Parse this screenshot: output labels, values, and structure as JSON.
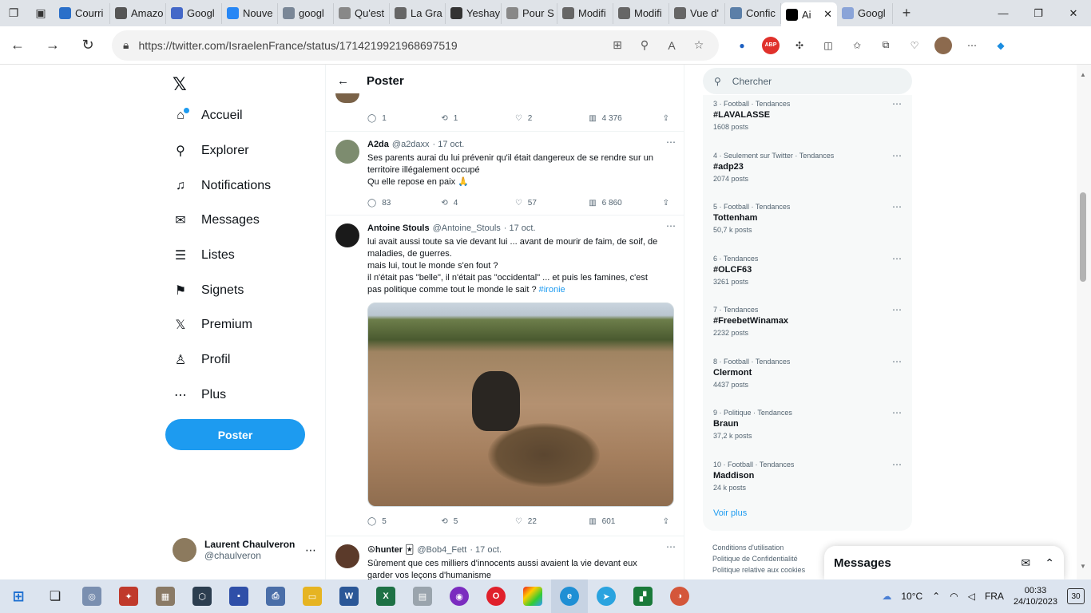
{
  "browser": {
    "tabs": [
      {
        "label": "Courri",
        "icon": "outlook-icon",
        "color": "#2a6fc9"
      },
      {
        "label": "Amazo",
        "icon": "amazon-icon",
        "color": "#555555"
      },
      {
        "label": "Googl",
        "icon": "google-icon",
        "color": "#4468c8"
      },
      {
        "label": "Nouve",
        "icon": "vk-icon",
        "color": "#2787f5"
      },
      {
        "label": "googl",
        "icon": "search-icon",
        "color": "#7a8797"
      },
      {
        "label": "Qu'est",
        "icon": "page-icon",
        "color": "#888888"
      },
      {
        "label": "La Gra",
        "icon": "wikipedia-icon",
        "color": "#666666"
      },
      {
        "label": "Yeshay",
        "icon": "wikipedia-icon",
        "color": "#333333"
      },
      {
        "label": "Pour S",
        "icon": "page-icon",
        "color": "#888888"
      },
      {
        "label": "Modifi",
        "icon": "page-icon",
        "color": "#666666"
      },
      {
        "label": "Modifi",
        "icon": "page-icon",
        "color": "#666666"
      },
      {
        "label": "Vue d'",
        "icon": "page-icon",
        "color": "#666666"
      },
      {
        "label": "Confic",
        "icon": "page-icon",
        "color": "#5b7fa8"
      },
      {
        "label": "Ai",
        "icon": "x-icon",
        "color": "#000000",
        "active": true
      },
      {
        "label": "Googl",
        "icon": "google-icon",
        "color": "#8aa4d8"
      }
    ],
    "url": "https://twitter.com/IsraelenFrance/status/1714219921968697519"
  },
  "sidebar": {
    "logo": "𝕏",
    "items": [
      {
        "label": "Accueil",
        "icon": "home-icon",
        "glyph": "⌂"
      },
      {
        "label": "Explorer",
        "icon": "search-icon",
        "glyph": "⚲"
      },
      {
        "label": "Notifications",
        "icon": "bell-icon",
        "glyph": "♫"
      },
      {
        "label": "Messages",
        "icon": "mail-icon",
        "glyph": "✉"
      },
      {
        "label": "Listes",
        "icon": "list-icon",
        "glyph": "☰"
      },
      {
        "label": "Signets",
        "icon": "bookmark-icon",
        "glyph": "⚑"
      },
      {
        "label": "Premium",
        "icon": "x-icon",
        "glyph": "𝕏"
      },
      {
        "label": "Profil",
        "icon": "profile-icon",
        "glyph": "♙"
      },
      {
        "label": "Plus",
        "icon": "more-icon",
        "glyph": "⋯"
      }
    ],
    "post_button": "Poster",
    "user": {
      "name": "Laurent Chaulveron",
      "handle": "@chaulveron"
    }
  },
  "feed": {
    "header": "Poster",
    "top_actions": {
      "replies": "1",
      "retweets": "1",
      "likes": "2",
      "views": "4 376"
    },
    "tweets": [
      {
        "name": "A2da",
        "handle": "@a2daxx",
        "date": "· 17 oct.",
        "lines": [
          "Ses parents aurai du lui prévenir qu'il était dangereux de se rendre sur un",
          "territoire illégalement occupé",
          "Qu elle repose en paix 🙏"
        ],
        "replies": "83",
        "retweets": "4",
        "likes": "57",
        "views": "6 860"
      },
      {
        "name": "Antoine Stouls",
        "handle": "@Antoine_Stouls",
        "date": "· 17 oct.",
        "lines": [
          "lui avait aussi toute sa vie devant lui ... avant de mourir de faim, de soif, de",
          "maladies, de guerres.",
          "mais lui, tout le monde s'en fout ?",
          "il n'était pas \"belle\", il n'était pas \"occidental\" ... et puis les famines, c'est",
          "pas politique comme tout le monde le sait ?"
        ],
        "hashtag": "#ironie",
        "replies": "5",
        "retweets": "5",
        "likes": "22",
        "views": "601"
      },
      {
        "name": "☮hunter 🃏",
        "handle": "@Bob4_Fett",
        "date": "· 17 oct.",
        "lines": [
          "Sûrement que ces milliers d'innocents aussi avaient la vie devant eux",
          "garder vos leçons d'humanisme"
        ]
      }
    ]
  },
  "right": {
    "search_placeholder": "Chercher",
    "trends": [
      {
        "category": "3 · Football · Tendances",
        "title": "#LAVALASSE",
        "posts": "1608 posts"
      },
      {
        "category": "4 · Seulement sur Twitter · Tendances",
        "title": "#adp23",
        "posts": "2074 posts"
      },
      {
        "category": "5 · Football · Tendances",
        "title": "Tottenham",
        "posts": "50,7 k posts"
      },
      {
        "category": "6 · Tendances",
        "title": "#OLCF63",
        "posts": "3261 posts"
      },
      {
        "category": "7 · Tendances",
        "title": "#FreebetWinamax",
        "posts": "2232 posts"
      },
      {
        "category": "8 · Football · Tendances",
        "title": "Clermont",
        "posts": "4437 posts"
      },
      {
        "category": "9 · Politique · Tendances",
        "title": "Braun",
        "posts": "37,2 k posts"
      },
      {
        "category": "10 · Football · Tendances",
        "title": "Maddison",
        "posts": "24 k posts"
      }
    ],
    "see_more": "Voir plus",
    "footer": [
      "Conditions d'utilisation",
      "Politique de Confidentialité",
      "Politique relative aux cookies"
    ]
  },
  "messages_drawer": {
    "title": "Messages"
  },
  "taskbar": {
    "weather": "10°C",
    "language": "FRA",
    "time": "00:33",
    "date": "24/10/2023",
    "notifications": "30"
  }
}
